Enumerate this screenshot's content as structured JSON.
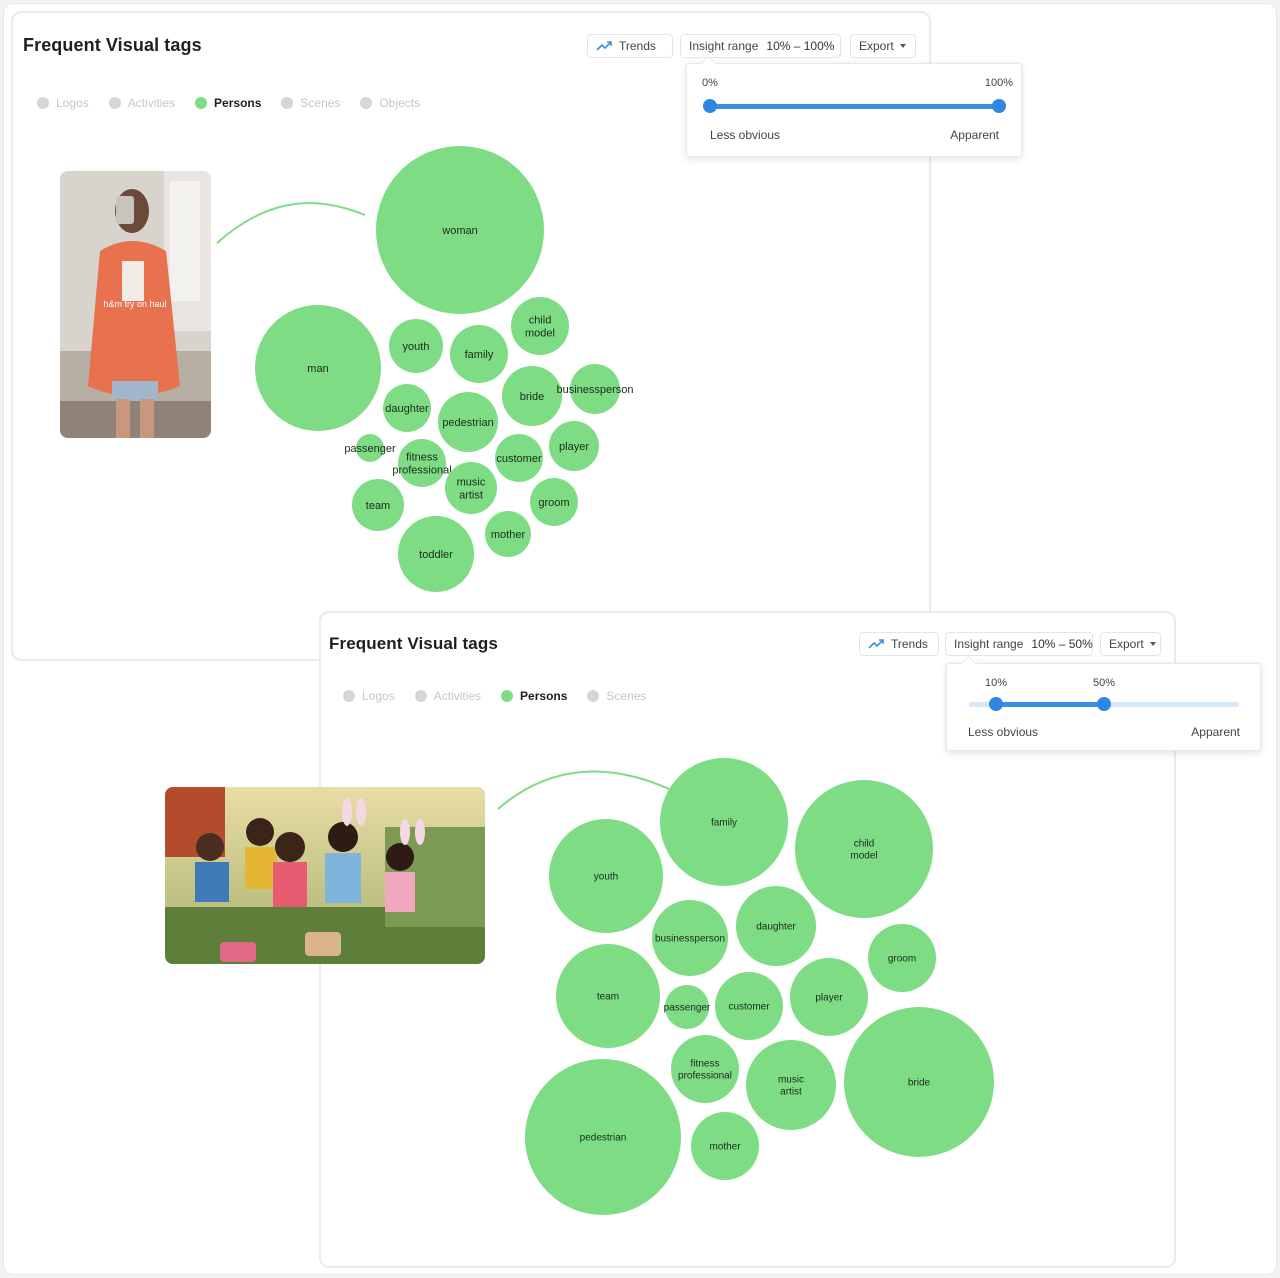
{
  "colors": {
    "bubble": "#7ddc84",
    "accent": "#3a8ee6",
    "inactive_dot": "#d4d6da"
  },
  "panels": [
    {
      "title": "Frequent Visual tags",
      "toolbar": {
        "trends_label": "Trends",
        "trends_icon": "trend-line-icon",
        "insight_label": "Insight range",
        "insight_value": "10% – 100%",
        "export_label": "Export"
      },
      "range_popover": {
        "min_label": "0%",
        "max_label": "100%",
        "min_value": 0,
        "max_value": 100,
        "left_caption": "Less obvious",
        "right_caption": "Apparent"
      },
      "legend": [
        {
          "label": "Logos",
          "active": false
        },
        {
          "label": "Activities",
          "active": false
        },
        {
          "label": "Persons",
          "active": true
        },
        {
          "label": "Scenes",
          "active": false
        },
        {
          "label": "Objects",
          "active": false
        }
      ],
      "thumbnail_caption": "h&m try on haul",
      "bubbles": [
        {
          "label": [
            "woman"
          ]
        },
        {
          "label": [
            "man"
          ]
        },
        {
          "label": [
            "youth"
          ]
        },
        {
          "label": [
            "family"
          ]
        },
        {
          "label": [
            "child",
            "model"
          ]
        },
        {
          "label": [
            "bride"
          ]
        },
        {
          "label": [
            "businessperson"
          ]
        },
        {
          "label": [
            "daughter"
          ]
        },
        {
          "label": [
            "pedestrian"
          ]
        },
        {
          "label": [
            "player"
          ]
        },
        {
          "label": [
            "customer"
          ]
        },
        {
          "label": [
            "passenger"
          ]
        },
        {
          "label": [
            "fitness",
            "professional"
          ]
        },
        {
          "label": [
            "music",
            "artist"
          ]
        },
        {
          "label": [
            "groom"
          ]
        },
        {
          "label": [
            "team"
          ]
        },
        {
          "label": [
            "mother"
          ]
        },
        {
          "label": [
            "toddler"
          ]
        }
      ]
    },
    {
      "title": "Frequent Visual tags",
      "toolbar": {
        "trends_label": "Trends",
        "trends_icon": "trend-line-icon",
        "insight_label": "Insight range",
        "insight_value": "10% – 50%",
        "export_label": "Export"
      },
      "range_popover": {
        "min_label": "10%",
        "max_label": "50%",
        "min_value": 10,
        "max_value": 50,
        "left_caption": "Less obvious",
        "right_caption": "Apparent"
      },
      "legend": [
        {
          "label": "Logos",
          "active": false
        },
        {
          "label": "Activities",
          "active": false
        },
        {
          "label": "Persons",
          "active": true
        },
        {
          "label": "Scenes",
          "active": false
        }
      ],
      "bubbles": [
        {
          "label": [
            "family"
          ]
        },
        {
          "label": [
            "youth"
          ]
        },
        {
          "label": [
            "child",
            "model"
          ]
        },
        {
          "label": [
            "daughter"
          ]
        },
        {
          "label": [
            "businessperson"
          ]
        },
        {
          "label": [
            "groom"
          ]
        },
        {
          "label": [
            "team"
          ]
        },
        {
          "label": [
            "passenger"
          ]
        },
        {
          "label": [
            "customer"
          ]
        },
        {
          "label": [
            "player"
          ]
        },
        {
          "label": [
            "fitness",
            "professional"
          ]
        },
        {
          "label": [
            "music",
            "artist"
          ]
        },
        {
          "label": [
            "bride"
          ]
        },
        {
          "label": [
            "pedestrian"
          ]
        },
        {
          "label": [
            "mother"
          ]
        }
      ]
    }
  ]
}
